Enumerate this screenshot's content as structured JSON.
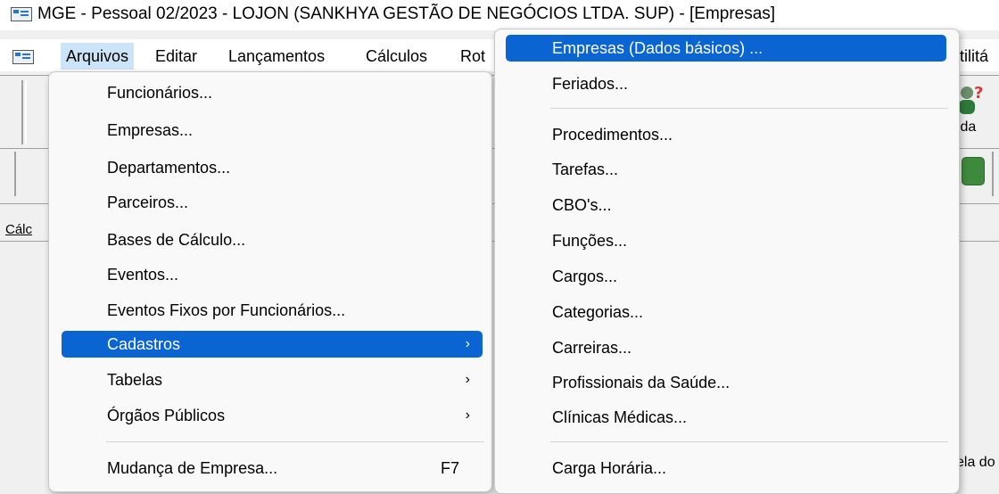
{
  "window": {
    "title": "MGE - Pessoal 02/2023 - LOJON (SANKHYA GESTÃO DE NEGÓCIOS LTDA. SUP) - [Empresas]"
  },
  "menubar": {
    "items": [
      {
        "label": "Arquivos"
      },
      {
        "label": "Editar"
      },
      {
        "label": "Lançamentos"
      },
      {
        "label": "Cálculos"
      },
      {
        "label": "Rot"
      }
    ],
    "right_label": "tilitá"
  },
  "toolbar": {
    "help_label": "juda"
  },
  "left_tab_label": "Cálc",
  "right_window_text": "ela do",
  "arquivos_menu": {
    "items": [
      {
        "label": "Funcionários..."
      },
      {
        "label": "Empresas..."
      },
      {
        "label": "Departamentos..."
      },
      {
        "label": "Parceiros..."
      },
      {
        "label": "Bases de Cálculo..."
      },
      {
        "label": "Eventos..."
      },
      {
        "label": "Eventos Fixos por Funcionários..."
      },
      {
        "label": "Cadastros",
        "has_submenu": true,
        "highlighted": true
      },
      {
        "label": "Tabelas",
        "has_submenu": true
      },
      {
        "label": "Órgãos Públicos",
        "has_submenu": true
      },
      {
        "label": "Mudança de Empresa...",
        "shortcut": "F7"
      }
    ],
    "arrow_glyph": "›"
  },
  "cadastros_menu": {
    "items": [
      {
        "label": "Empresas (Dados básicos) ...",
        "highlighted": true
      },
      {
        "label": "Feriados..."
      },
      {
        "label": "Procedimentos..."
      },
      {
        "label": "Tarefas..."
      },
      {
        "label": "CBO's..."
      },
      {
        "label": "Funções..."
      },
      {
        "label": "Cargos..."
      },
      {
        "label": "Categorias..."
      },
      {
        "label": "Carreiras..."
      },
      {
        "label": "Profissionais da Saúde..."
      },
      {
        "label": "Clínicas Médicas..."
      },
      {
        "label": "Carga Horária..."
      }
    ]
  },
  "colors": {
    "highlight": "#0a64d1",
    "open_menu_bg": "#cce4f7"
  }
}
